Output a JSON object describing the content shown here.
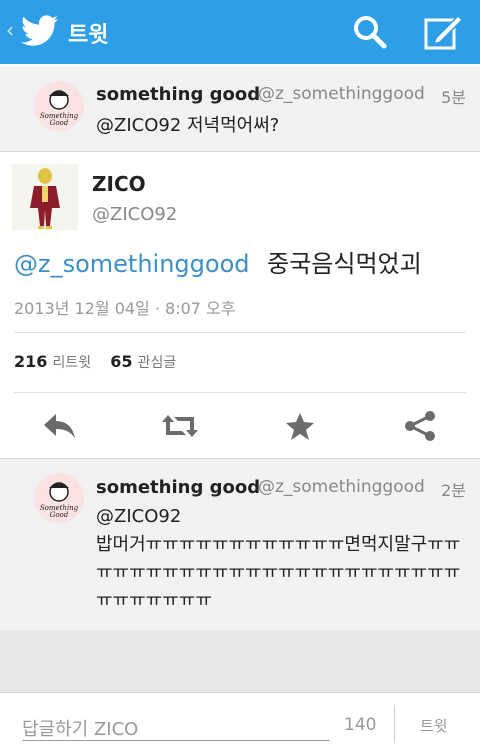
{
  "header": {
    "back_glyph": "‹",
    "title": "트윗",
    "logo_icon": "twitter-bird-icon",
    "search_icon": "search-icon",
    "compose_icon": "compose-icon"
  },
  "prev_tweet": {
    "name": "something good",
    "handle": "@z_somethinggood",
    "time": "5분",
    "text": "@ZICO92 저녁먹어써?"
  },
  "main_tweet": {
    "name": "ZICO",
    "handle": "@ZICO92",
    "mention": "@z_somethinggood",
    "body": "중국음식먹었괴",
    "date": "2013년 12월 04일 · 8:07 오후",
    "retweets_count": "216",
    "retweets_label": "리트윗",
    "favorites_count": "65",
    "favorites_label": "관심글"
  },
  "actions": [
    "reply-icon",
    "retweet-icon",
    "star-icon",
    "share-icon"
  ],
  "reply_tweet": {
    "name": "something good",
    "handle": "@z_somethinggood",
    "time": "2분",
    "mention": "@ZICO92",
    "text": "밥머거ㅠㅠㅠㅠㅠㅠㅠㅠㅠㅠㅠㅠ면먹지말구ㅠㅠㅠㅠㅠㅠㅠㅠㅠㅠㅠㅠㅠㅠㅠㅠㅠㅠㅠㅠㅠㅠㅠㅠㅠㅠㅠㅠㅠㅠㅠ"
  },
  "reply_bar": {
    "placeholder": "답글하기 ZICO",
    "char_count": "140",
    "send_label": "트윗"
  },
  "colors": {
    "header_bg": "#2e9fe6",
    "mention": "#3d8fc9"
  }
}
